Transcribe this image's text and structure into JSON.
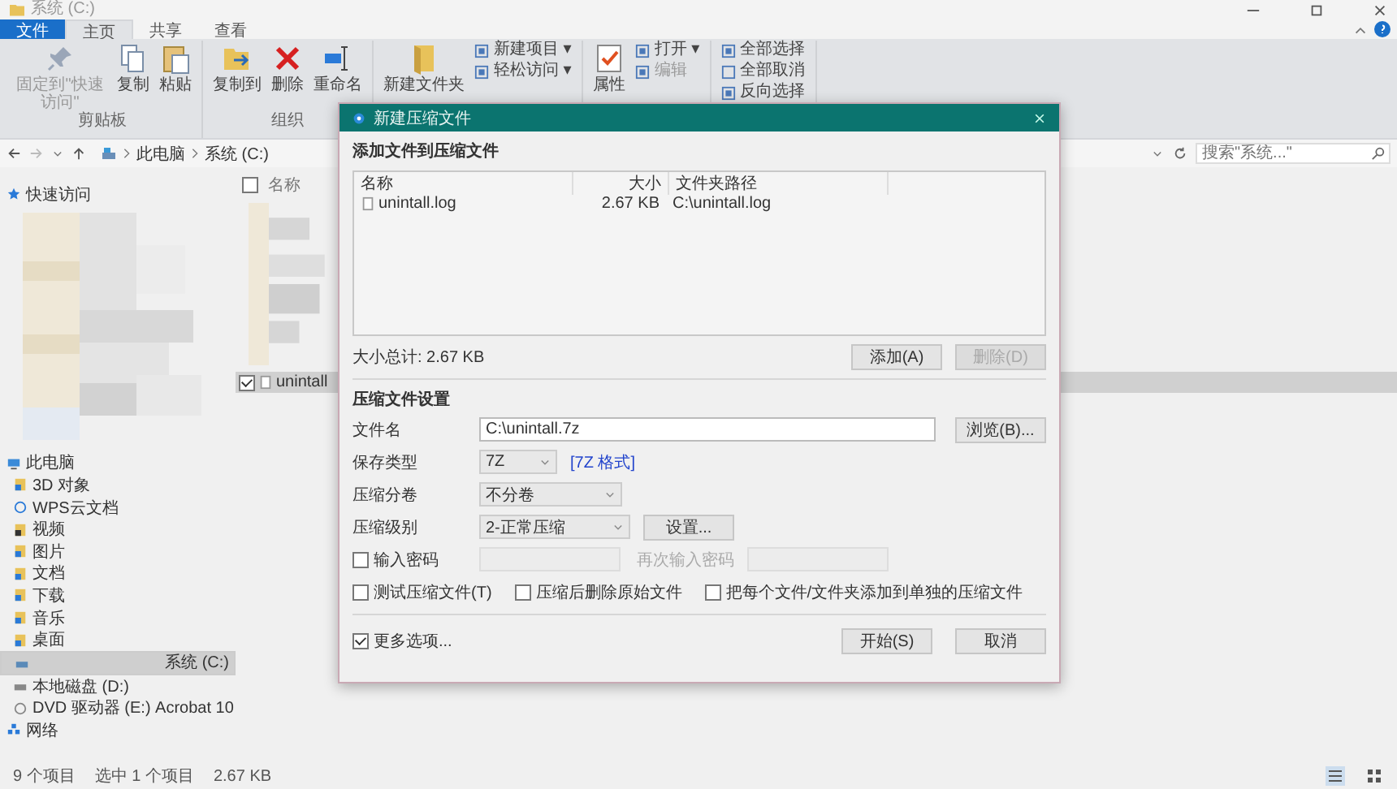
{
  "window": {
    "title": "系统 (C:)"
  },
  "ribbon_tabs": [
    {
      "label": "文件",
      "kind": "file",
      "selected": false
    },
    {
      "label": "主页",
      "kind": "tab",
      "selected": true
    },
    {
      "label": "共享",
      "kind": "tab",
      "selected": false
    },
    {
      "label": "查看",
      "kind": "tab",
      "selected": false
    }
  ],
  "ribbon_groups": [
    {
      "label": "剪贴板",
      "items": [
        {
          "kind": "large",
          "label": "固定到\"快速访问\"",
          "disabled": true
        },
        {
          "kind": "large",
          "label": "复制",
          "disabled": false
        },
        {
          "kind": "large",
          "label": "粘贴",
          "disabled": false
        }
      ]
    },
    {
      "label": "组织",
      "items": [
        {
          "kind": "large",
          "label": "复制到",
          "disabled": false
        },
        {
          "kind": "large",
          "label": "删除",
          "disabled": false
        },
        {
          "kind": "large",
          "label": "重命名",
          "disabled": false
        }
      ]
    },
    {
      "items": [
        {
          "kind": "large",
          "label": "新建文件夹",
          "disabled": false
        },
        {
          "kind": "small",
          "label": "新建项目 ▾",
          "disabled": false
        },
        {
          "kind": "small",
          "label": "轻松访问 ▾",
          "disabled": false
        }
      ]
    },
    {
      "items": [
        {
          "kind": "large",
          "label": "属性",
          "disabled": false
        },
        {
          "kind": "small",
          "label": "打开 ▾",
          "disabled": false
        },
        {
          "kind": "small",
          "label": "编辑",
          "disabled": true
        }
      ]
    },
    {
      "items": [
        {
          "kind": "small",
          "label": "全部选择",
          "disabled": false
        },
        {
          "kind": "small",
          "label": "全部取消",
          "disabled": false
        },
        {
          "kind": "small",
          "label": "反向选择",
          "disabled": false
        }
      ]
    }
  ],
  "address": {
    "path": [
      "此电脑",
      "系统 (C:)"
    ],
    "search_placeholder": "搜索\"系统...\""
  },
  "nav_tree": [
    {
      "label": "快速访问",
      "selected": false
    },
    {
      "label": "此电脑",
      "selected": false,
      "children": [
        {
          "label": "3D 对象",
          "selected": false
        },
        {
          "label": "WPS云文档",
          "selected": false
        },
        {
          "label": "视频",
          "selected": false
        },
        {
          "label": "图片",
          "selected": false
        },
        {
          "label": "文档",
          "selected": false
        },
        {
          "label": "下载",
          "selected": false
        },
        {
          "label": "音乐",
          "selected": false
        },
        {
          "label": "桌面",
          "selected": false
        },
        {
          "label": "系统 (C:)",
          "selected": true
        },
        {
          "label": "本地磁盘 (D:)",
          "selected": false
        },
        {
          "label": "DVD 驱动器 (E:) Acrobat 10",
          "selected": false
        }
      ]
    },
    {
      "label": "网络",
      "selected": false
    }
  ],
  "file_list": {
    "header": "名称",
    "header_checked": false,
    "files": [
      {
        "name": "unintall",
        "selected": true,
        "checked": true
      }
    ]
  },
  "status_bar": {
    "count": "9 个项目",
    "selection": "选中 1 个项目",
    "size": "2.67 KB"
  },
  "dialog": {
    "title": "新建压缩文件",
    "files_section": "添加文件到压缩文件",
    "columns": [
      "名称",
      "大小",
      "文件夹路径"
    ],
    "rows": [
      {
        "name": "unintall.log",
        "size": "2.67 KB",
        "path": "C:\\unintall.log"
      }
    ],
    "total": "大小总计: 2.67 KB",
    "list_buttons": [
      {
        "label": "添加(A)",
        "disabled": false
      },
      {
        "label": "删除(D)",
        "disabled": true
      }
    ],
    "settings_section": "压缩文件设置",
    "fields": [
      {
        "kind": "text",
        "label": "文件名",
        "value": "C:\\unintall.7z",
        "button": "浏览(B)..."
      },
      {
        "kind": "select",
        "label": "保存类型",
        "value": "7Z",
        "link": "[7Z 格式]"
      },
      {
        "kind": "select",
        "label": "压缩分卷",
        "value": "不分卷"
      },
      {
        "kind": "select",
        "label": "压缩级别",
        "value": "2-正常压缩",
        "button": "设置..."
      }
    ],
    "password": {
      "label": "输入密码",
      "checked": false,
      "confirm_label": "再次输入密码"
    },
    "options": [
      {
        "label": "测试压缩文件(T)",
        "checked": false
      },
      {
        "label": "压缩后删除原始文件",
        "checked": false
      },
      {
        "label": "把每个文件/文件夹添加到单独的压缩文件",
        "checked": false
      }
    ],
    "more": {
      "label": "更多选项...",
      "checked": true
    },
    "buttons": [
      "开始(S)",
      "取消"
    ]
  }
}
